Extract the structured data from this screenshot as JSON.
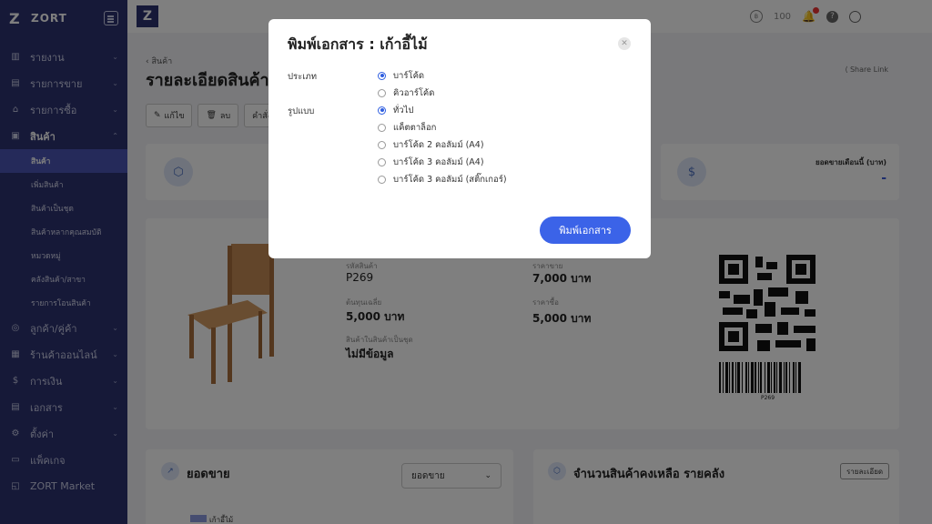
{
  "app": {
    "brand_logo": "Z",
    "brand_name": "ZORT"
  },
  "sidebar": {
    "items": [
      {
        "label": "รายงาน",
        "icon": "bar-chart-icon",
        "glyph": "▥",
        "chev": "⌄"
      },
      {
        "label": "รายการขาย",
        "icon": "receipt-icon",
        "glyph": "▤",
        "chev": "⌄"
      },
      {
        "label": "รายการซื้อ",
        "icon": "basket-icon",
        "glyph": "⌂",
        "chev": "⌄"
      }
    ],
    "product_section": {
      "label": "สินค้า",
      "icon": "box-icon",
      "glyph": "▣",
      "chev": "⌃"
    },
    "product_sub": [
      {
        "label": "สินค้า"
      },
      {
        "label": "เพิ่มสินค้า"
      },
      {
        "label": "สินค้าเป็นชุด"
      },
      {
        "label": "สินค้าหลากคุณสมบัติ"
      },
      {
        "label": "หมวดหมู่"
      },
      {
        "label": "คลังสินค้า/สาขา"
      },
      {
        "label": "รายการโอนสินค้า"
      }
    ],
    "items_after": [
      {
        "label": "ลูกค้า/คู่ค้า",
        "icon": "handshake-icon",
        "glyph": "◎",
        "chev": "⌄"
      },
      {
        "label": "ร้านค้าออนไลน์",
        "icon": "store-icon",
        "glyph": "▦",
        "chev": "⌄"
      },
      {
        "label": "การเงิน",
        "icon": "money-icon",
        "glyph": "$",
        "chev": "⌄"
      },
      {
        "label": "เอกสาร",
        "icon": "document-icon",
        "glyph": "▤",
        "chev": "⌄"
      },
      {
        "label": "ตั้งค่า",
        "icon": "gear-icon",
        "glyph": "⚙",
        "chev": "⌄"
      },
      {
        "label": "แพ็คเกจ",
        "icon": "package-icon",
        "glyph": "▭",
        "chev": ""
      },
      {
        "label": "ZORT Market",
        "icon": "market-icon",
        "glyph": "◱",
        "chev": ""
      }
    ]
  },
  "topbar": {
    "logo": "Z",
    "coin_glyph": "฿",
    "credits": "100",
    "bell_glyph": "🔔",
    "help_glyph": "?"
  },
  "page": {
    "breadcrumb": "‹ สินค้า",
    "title": "รายละเอียดสินค้า",
    "share_link": "⟨ Share Link",
    "actions": [
      {
        "label": "แก้ไข",
        "glyph": "✎"
      },
      {
        "label": "ลบ",
        "glyph": "🗑"
      },
      {
        "label": "คำสั่ง",
        "glyph": ""
      }
    ]
  },
  "stats": {
    "left_icon_glyph": "⬡",
    "right_icon_glyph": "$",
    "right_label": "ยอดขายเดือนนี้ (บาท)",
    "right_value": "-"
  },
  "product": {
    "code_label": "รหัสสินค้า",
    "code_value": "P269",
    "cost_label": "ต้นทุนเฉลี่ย",
    "cost_value": "5,000 บาท",
    "bundle_label": "สินค้าในสินค้าเป็นชุด",
    "bundle_value": "ไม่มีข้อมูล",
    "sell_label": "ราคาขาย",
    "sell_value": "7,000 บาท",
    "buy_label": "ราคาซื้อ",
    "buy_value": "5,000 บาท",
    "barcode_caption": "P269"
  },
  "sales_panel": {
    "title": "ยอดขาย",
    "icon_glyph": "↗",
    "select_value": "ยอดขาย",
    "select_caret": "⌄",
    "legend": "เก้าอี้ไม้"
  },
  "stock_panel": {
    "title": "จำนวนสินค้าคงเหลือ รายคลัง",
    "icon_glyph": "⬡",
    "detail_button": "รายละเอียด"
  },
  "modal": {
    "title": "พิมพ์เอกสาร : เก้าอี้ไม้",
    "close_glyph": "✕",
    "type_label": "ประเภท",
    "type_options": [
      {
        "label": "บาร์โค้ด",
        "checked": true
      },
      {
        "label": "คิวอาร์โค้ด",
        "checked": false
      }
    ],
    "format_label": "รูปแบบ",
    "format_options": [
      {
        "label": "ทั่วไป",
        "checked": true
      },
      {
        "label": "แค็ตตาล็อก",
        "checked": false
      },
      {
        "label": "บาร์โค้ด 2 คอลัมม์ (A4)",
        "checked": false
      },
      {
        "label": "บาร์โค้ด 3 คอลัมม์ (A4)",
        "checked": false
      },
      {
        "label": "บาร์โค้ด 3 คอลัมม์ (สติ๊กเกอร์)",
        "checked": false
      }
    ],
    "print_button": "พิมพ์เอกสาร"
  },
  "colors": {
    "sidebar": "#2c3270",
    "sidebar_active": "#4a55b5",
    "accent": "#3b63e8",
    "notification": "#e33333"
  }
}
